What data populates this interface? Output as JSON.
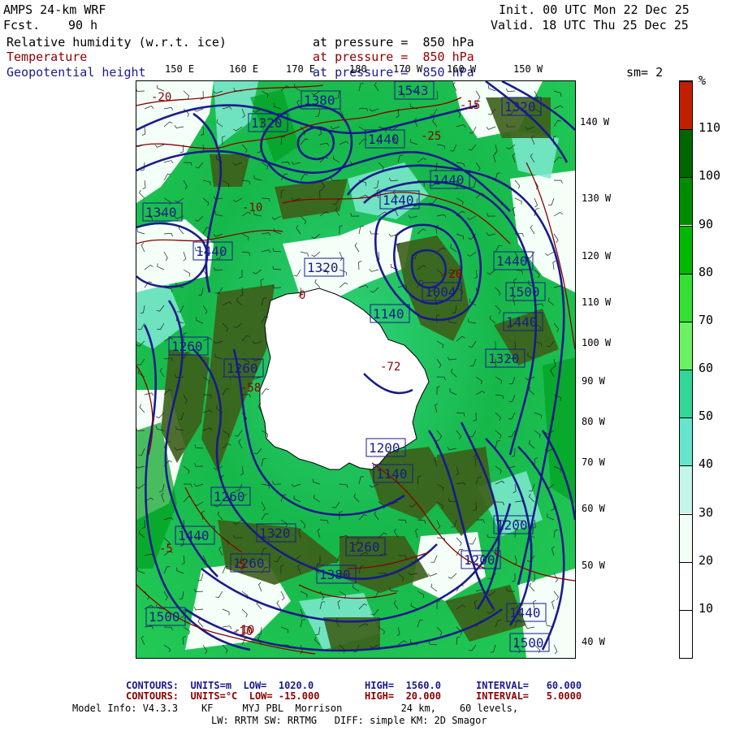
{
  "header": {
    "model": "AMPS 24-km WRF",
    "fcst_label": "Fcst.",
    "fcst_value": "90 h",
    "init": "Init. 00 UTC Mon 22 Dec 25",
    "valid": "Valid. 18 UTC Thu 25 Dec 25",
    "fields": [
      {
        "name": "Relative humidity (w.r.t. ice)",
        "level": "at pressure =  850 hPa",
        "color": "#000000"
      },
      {
        "name": "Temperature",
        "level": "at pressure =  850 hPa",
        "color": "#8b0000"
      },
      {
        "name": "Geopotential height",
        "level": "at pressure =  850 hPa",
        "color": "#1a1a8c"
      }
    ],
    "smoothing": "sm= 2"
  },
  "map": {
    "top_longitudes": [
      "150 E",
      "160 E",
      "170 E",
      "180",
      "170 W",
      "160 W",
      "150 W"
    ],
    "right_longitudes": [
      "140 W",
      "130 W",
      "120 W",
      "110 W",
      "100 W",
      "90 W",
      "80 W",
      "70 W",
      "60 W",
      "50 W",
      "40 W"
    ],
    "height_labels": [
      "1543",
      "1440",
      "1380",
      "1320",
      "1440",
      "1440",
      "1320",
      "1340",
      "1440",
      "1500",
      "1004",
      "1320",
      "1440",
      "1440",
      "1260",
      "1260",
      "1140",
      "1320",
      "1200",
      "1140",
      "1260",
      "1200",
      "1320",
      "1260",
      "1200",
      "1260",
      "1380",
      "1440",
      "1500",
      "1440",
      "1500"
    ],
    "temperature_labels": [
      "-20",
      "-15",
      "-10",
      "-5",
      "-25",
      "-20",
      "-10",
      "-5",
      "0",
      "-72",
      "-58",
      "-10"
    ],
    "colors": {
      "height_contour": "#1a1a8c",
      "temp_contour": "#8b0000",
      "antarctica": "#ffffff"
    }
  },
  "colorbar": {
    "unit": "%",
    "ticks": [
      "110",
      "100",
      "90",
      "80",
      "70",
      "60",
      "50",
      "40",
      "30",
      "20",
      "10"
    ],
    "colors": [
      "#ffffff",
      "#ffffff",
      "#f2fff6",
      "#c4f5e8",
      "#66e5cc",
      "#33d699",
      "#6ef064",
      "#33e033",
      "#00b800",
      "#008c00",
      "#006600",
      "#3f5f00",
      "#c02000"
    ]
  },
  "footer": {
    "line1_label": "CONTOURS:  UNITS=m  LOW=  1020.0",
    "line1_high": "HIGH=  1560.0",
    "line1_int": "INTERVAL=   60.000",
    "line2_label": "CONTOURS:  UNITS=°C  LOW= -15.000",
    "line2_high": "HIGH=  20.000",
    "line2_int": "INTERVAL=   5.0000",
    "line3": "Model Info: V4.3.3    KF     MYJ PBL  Morrison          24 km,    60 levels,",
    "line4": "LW: RRTM SW: RRTMG   DIFF: simple KM: 2D Smagor"
  }
}
